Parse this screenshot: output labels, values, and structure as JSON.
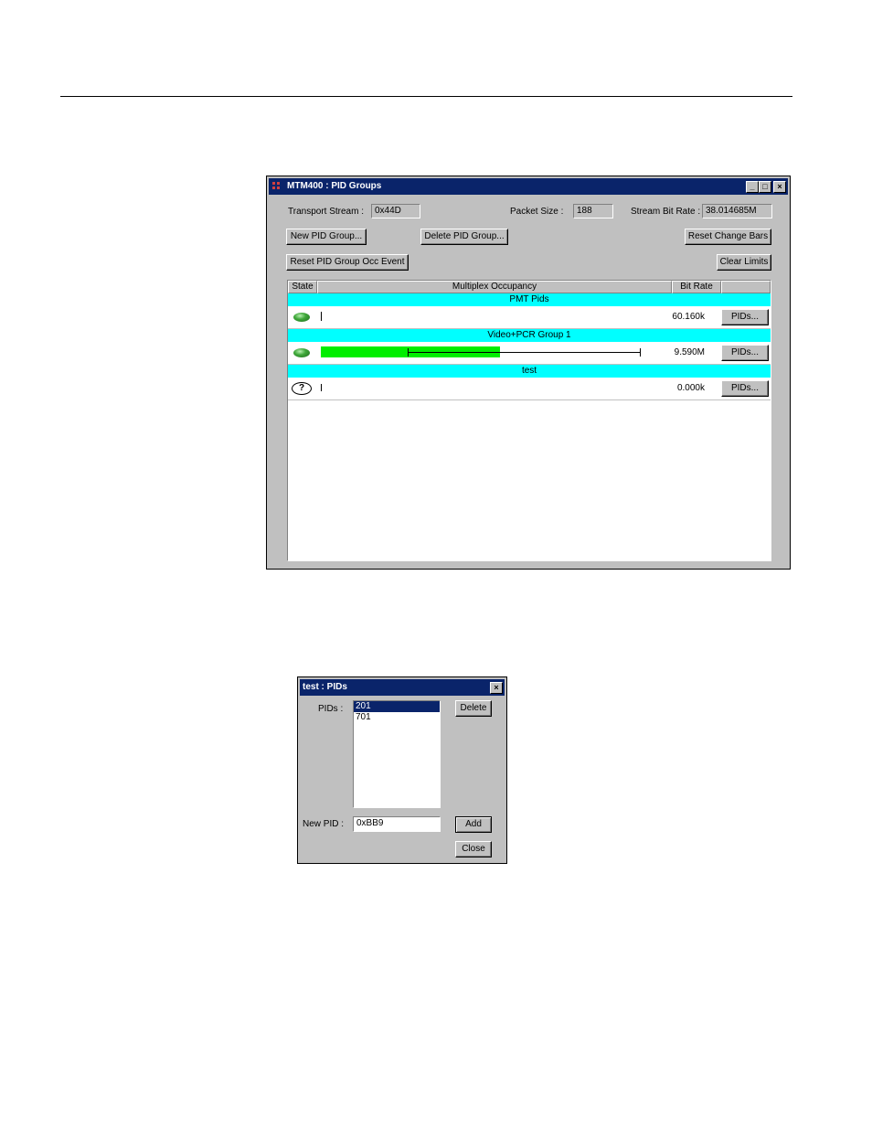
{
  "main_window": {
    "title": "MTM400 : PID Groups",
    "title_buttons": {
      "minimize": "_",
      "maximize": "□",
      "close": "×"
    },
    "transport_stream_label": "Transport Stream :",
    "transport_stream_value": "0x44D",
    "packet_size_label": "Packet Size :",
    "packet_size_value": "188",
    "stream_bit_rate_label": "Stream Bit Rate :",
    "stream_bit_rate_value": "38.014685M",
    "buttons": {
      "new_group": "New PID Group...",
      "delete_group": "Delete PID Group...",
      "reset_change_bars": "Reset Change Bars",
      "reset_occ_event": "Reset PID Group Occ Event",
      "clear_limits": "Clear Limits"
    },
    "columns": {
      "state": "State",
      "occupancy": "Multiplex Occupancy",
      "bit_rate": "Bit Rate",
      "action": ""
    },
    "groups": [
      {
        "name": "PMT Pids",
        "state": "ok",
        "occupancy_fraction": 0.0,
        "bit_rate": "60.160k",
        "pids_button": "PIDs..."
      },
      {
        "name": "Video+PCR Group 1",
        "state": "ok",
        "occupancy_fraction": 0.56,
        "range_min_fraction": 0.27,
        "range_max_fraction": 1.0,
        "bit_rate": "9.590M",
        "pids_button": "PIDs..."
      },
      {
        "name": "test",
        "state": "unknown",
        "state_glyph": "?",
        "occupancy_fraction": 0.0,
        "bit_rate": "0.000k",
        "pids_button": "PIDs..."
      }
    ],
    "colors": {
      "titlebar": "#0a246a",
      "group_band": "#00ffff",
      "occupancy_fill": "#00ee00",
      "led_ok": "#3fa83a"
    }
  },
  "pids_dialog": {
    "title": "test : PIDs",
    "close_glyph": "×",
    "pids_label": "PIDs :",
    "pid_list": [
      "201",
      "701"
    ],
    "selected_index": 0,
    "delete_button": "Delete",
    "new_pid_label": "New PID :",
    "new_pid_value": "0xBB9",
    "add_button": "Add",
    "close_button": "Close"
  }
}
